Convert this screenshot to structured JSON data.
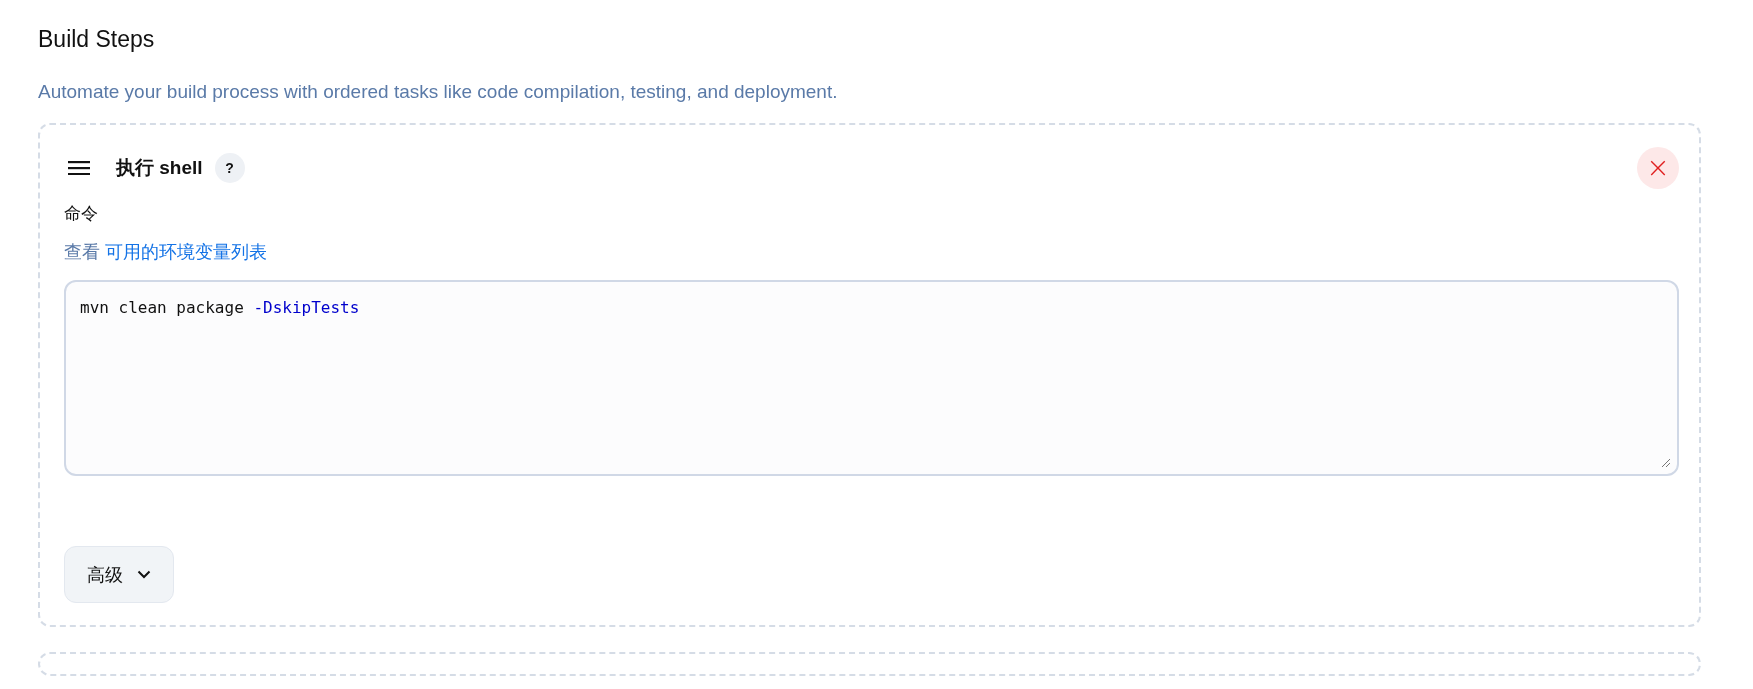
{
  "section": {
    "title": "Build Steps",
    "description": "Automate your build process with ordered tasks like code compilation, testing, and deployment."
  },
  "steps": [
    {
      "title": "执行 shell",
      "help": "?",
      "close": "×",
      "field_label": "命令",
      "hint": "查看",
      "hint_link": "可用的环境变量列表",
      "command": [
        {
          "kind": "plain",
          "text": "mvn clean package "
        },
        {
          "kind": "flag",
          "text": "-DskipTests"
        }
      ],
      "advanced": {
        "label": "高级",
        "expanded": false
      }
    }
  ]
}
